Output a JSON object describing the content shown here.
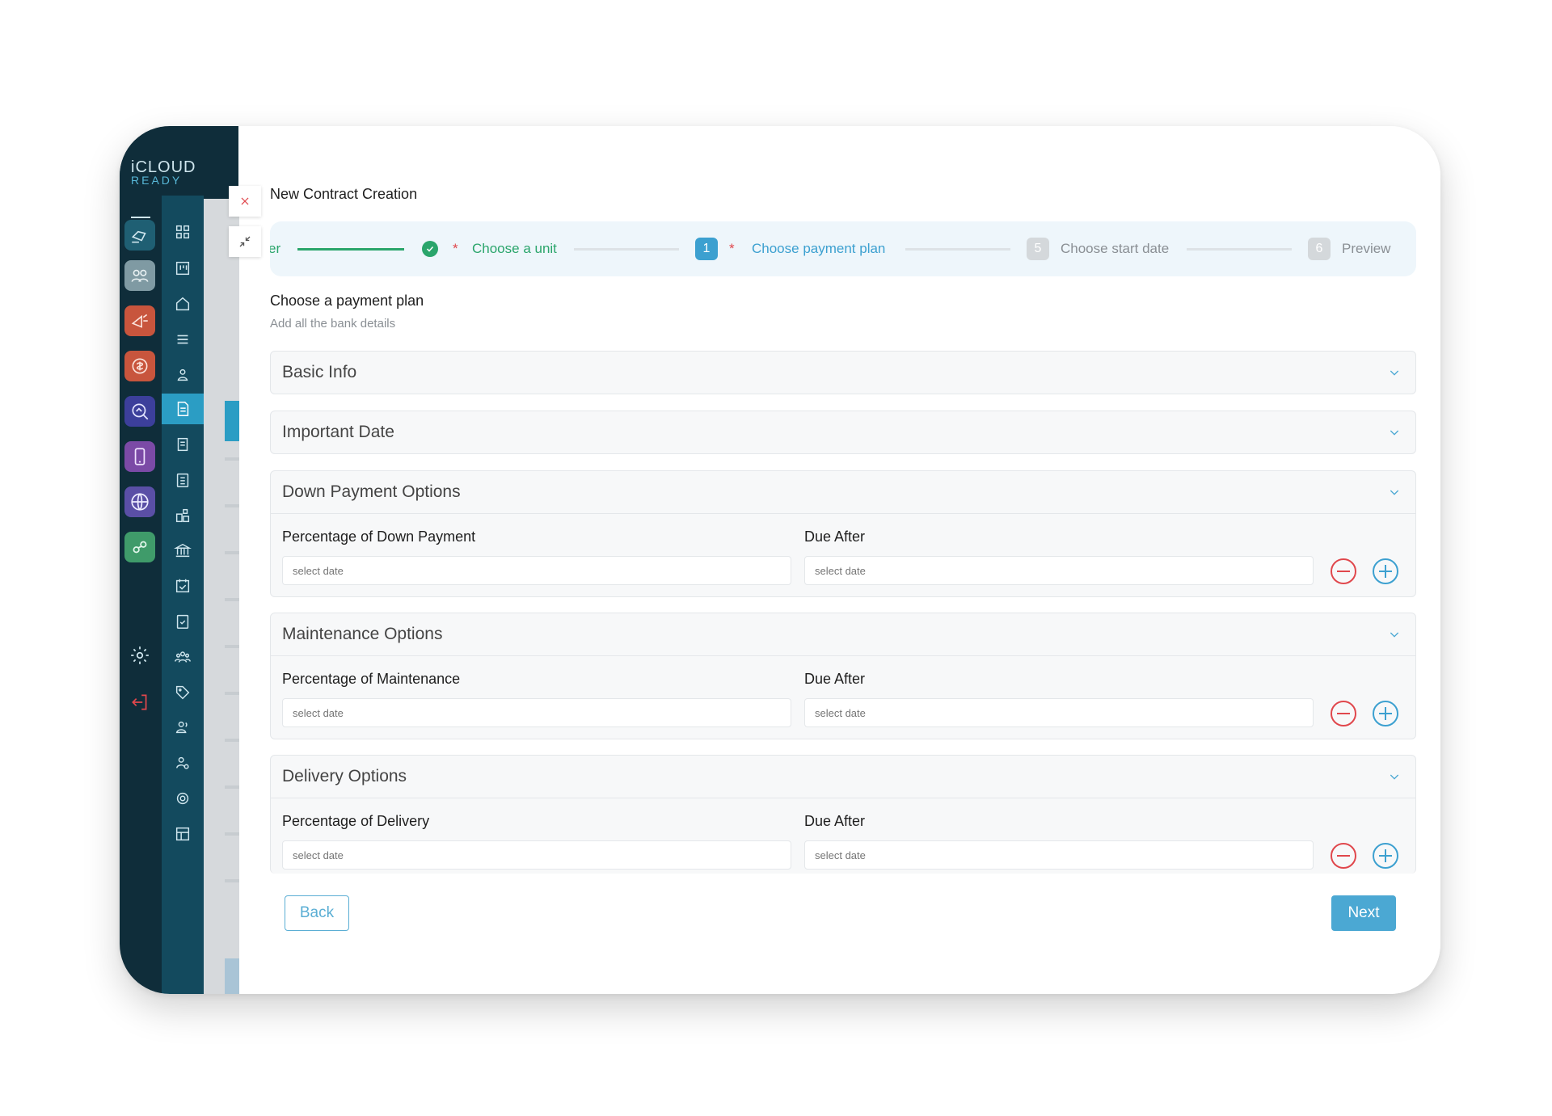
{
  "app": {
    "logo_line1": "iCLOUD",
    "logo_line2": "READY"
  },
  "rail_apps": [
    {
      "icon": "megaphone-hand-icon",
      "color": "#1f5f73"
    },
    {
      "icon": "group-icon",
      "color": "#7f9aa3"
    },
    {
      "icon": "marketing-icon",
      "color": "#c8553d"
    },
    {
      "icon": "money-icon",
      "color": "#c8553d"
    },
    {
      "icon": "search-home-icon",
      "color": "#3c3f9b"
    },
    {
      "icon": "mobile-icon",
      "color": "#7b4aa6"
    },
    {
      "icon": "globe-icon",
      "color": "#5a4fa6"
    },
    {
      "icon": "link-icon",
      "color": "#3f9b6a"
    }
  ],
  "modal": {
    "title": "New Contract Creation",
    "close_icon": "close-icon",
    "collapse_icon": "collapse-icon"
  },
  "stepper": {
    "prev_fragment": "er",
    "step_unit": {
      "label": "Choose a unit",
      "status": "done",
      "color": "#2aa56b"
    },
    "step_plan": {
      "number": "1",
      "label": "Choose payment plan",
      "status": "active",
      "color": "#3ca0d0"
    },
    "step_start": {
      "number": "5",
      "label": "Choose start date",
      "status": "pending"
    },
    "step_preview": {
      "number": "6",
      "label": "Preview",
      "status": "pending"
    },
    "required_mark": "*"
  },
  "section": {
    "title": "Choose a payment plan",
    "subtitle": "Add all the bank details"
  },
  "accordions": {
    "basic_info": {
      "title": "Basic Info"
    },
    "important_date": {
      "title": "Important Date"
    },
    "down_payment": {
      "title": "Down Payment Options",
      "left_label": "Percentage of Down Payment",
      "right_label": "Due After",
      "left_placeholder": "select date",
      "right_placeholder": "select date"
    },
    "maintenance": {
      "title": "Maintenance Options",
      "left_label": "Percentage of Maintenance",
      "right_label": "Due After",
      "left_placeholder": "select date",
      "right_placeholder": "select date"
    },
    "delivery": {
      "title": "Delivery Options",
      "left_label": "Percentage of Delivery",
      "right_label": "Due After",
      "left_placeholder": "select date",
      "right_placeholder": "select date"
    }
  },
  "footer": {
    "back_label": "Back",
    "next_label": "Next"
  },
  "colors": {
    "accent": "#4ba8d3",
    "success": "#2aa56b",
    "danger": "#e0474c",
    "sidebar_dark": "#0f2d3a",
    "sidebar": "#134a5e"
  }
}
